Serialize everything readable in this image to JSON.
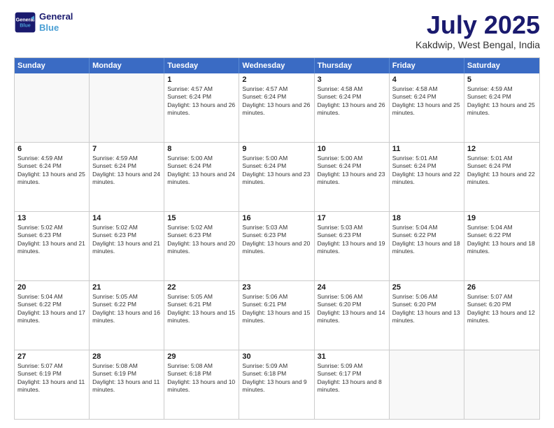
{
  "header": {
    "logo_line1": "General",
    "logo_line2": "Blue",
    "month": "July 2025",
    "location": "Kakdwip, West Bengal, India"
  },
  "days_of_week": [
    "Sunday",
    "Monday",
    "Tuesday",
    "Wednesday",
    "Thursday",
    "Friday",
    "Saturday"
  ],
  "weeks": [
    [
      {
        "day": "",
        "empty": true
      },
      {
        "day": "",
        "empty": true
      },
      {
        "day": "1",
        "sunrise": "4:57 AM",
        "sunset": "6:24 PM",
        "daylight": "13 hours and 26 minutes"
      },
      {
        "day": "2",
        "sunrise": "4:57 AM",
        "sunset": "6:24 PM",
        "daylight": "13 hours and 26 minutes"
      },
      {
        "day": "3",
        "sunrise": "4:58 AM",
        "sunset": "6:24 PM",
        "daylight": "13 hours and 26 minutes"
      },
      {
        "day": "4",
        "sunrise": "4:58 AM",
        "sunset": "6:24 PM",
        "daylight": "13 hours and 25 minutes"
      },
      {
        "day": "5",
        "sunrise": "4:59 AM",
        "sunset": "6:24 PM",
        "daylight": "13 hours and 25 minutes"
      }
    ],
    [
      {
        "day": "6",
        "sunrise": "4:59 AM",
        "sunset": "6:24 PM",
        "daylight": "13 hours and 25 minutes"
      },
      {
        "day": "7",
        "sunrise": "4:59 AM",
        "sunset": "6:24 PM",
        "daylight": "13 hours and 24 minutes"
      },
      {
        "day": "8",
        "sunrise": "5:00 AM",
        "sunset": "6:24 PM",
        "daylight": "13 hours and 24 minutes"
      },
      {
        "day": "9",
        "sunrise": "5:00 AM",
        "sunset": "6:24 PM",
        "daylight": "13 hours and 23 minutes"
      },
      {
        "day": "10",
        "sunrise": "5:00 AM",
        "sunset": "6:24 PM",
        "daylight": "13 hours and 23 minutes"
      },
      {
        "day": "11",
        "sunrise": "5:01 AM",
        "sunset": "6:24 PM",
        "daylight": "13 hours and 22 minutes"
      },
      {
        "day": "12",
        "sunrise": "5:01 AM",
        "sunset": "6:24 PM",
        "daylight": "13 hours and 22 minutes"
      }
    ],
    [
      {
        "day": "13",
        "sunrise": "5:02 AM",
        "sunset": "6:23 PM",
        "daylight": "13 hours and 21 minutes"
      },
      {
        "day": "14",
        "sunrise": "5:02 AM",
        "sunset": "6:23 PM",
        "daylight": "13 hours and 21 minutes"
      },
      {
        "day": "15",
        "sunrise": "5:02 AM",
        "sunset": "6:23 PM",
        "daylight": "13 hours and 20 minutes"
      },
      {
        "day": "16",
        "sunrise": "5:03 AM",
        "sunset": "6:23 PM",
        "daylight": "13 hours and 20 minutes"
      },
      {
        "day": "17",
        "sunrise": "5:03 AM",
        "sunset": "6:23 PM",
        "daylight": "13 hours and 19 minutes"
      },
      {
        "day": "18",
        "sunrise": "5:04 AM",
        "sunset": "6:22 PM",
        "daylight": "13 hours and 18 minutes"
      },
      {
        "day": "19",
        "sunrise": "5:04 AM",
        "sunset": "6:22 PM",
        "daylight": "13 hours and 18 minutes"
      }
    ],
    [
      {
        "day": "20",
        "sunrise": "5:04 AM",
        "sunset": "6:22 PM",
        "daylight": "13 hours and 17 minutes"
      },
      {
        "day": "21",
        "sunrise": "5:05 AM",
        "sunset": "6:22 PM",
        "daylight": "13 hours and 16 minutes"
      },
      {
        "day": "22",
        "sunrise": "5:05 AM",
        "sunset": "6:21 PM",
        "daylight": "13 hours and 15 minutes"
      },
      {
        "day": "23",
        "sunrise": "5:06 AM",
        "sunset": "6:21 PM",
        "daylight": "13 hours and 15 minutes"
      },
      {
        "day": "24",
        "sunrise": "5:06 AM",
        "sunset": "6:20 PM",
        "daylight": "13 hours and 14 minutes"
      },
      {
        "day": "25",
        "sunrise": "5:06 AM",
        "sunset": "6:20 PM",
        "daylight": "13 hours and 13 minutes"
      },
      {
        "day": "26",
        "sunrise": "5:07 AM",
        "sunset": "6:20 PM",
        "daylight": "13 hours and 12 minutes"
      }
    ],
    [
      {
        "day": "27",
        "sunrise": "5:07 AM",
        "sunset": "6:19 PM",
        "daylight": "13 hours and 11 minutes"
      },
      {
        "day": "28",
        "sunrise": "5:08 AM",
        "sunset": "6:19 PM",
        "daylight": "13 hours and 11 minutes"
      },
      {
        "day": "29",
        "sunrise": "5:08 AM",
        "sunset": "6:18 PM",
        "daylight": "13 hours and 10 minutes"
      },
      {
        "day": "30",
        "sunrise": "5:09 AM",
        "sunset": "6:18 PM",
        "daylight": "13 hours and 9 minutes"
      },
      {
        "day": "31",
        "sunrise": "5:09 AM",
        "sunset": "6:17 PM",
        "daylight": "13 hours and 8 minutes"
      },
      {
        "day": "",
        "empty": true
      },
      {
        "day": "",
        "empty": true
      }
    ]
  ]
}
